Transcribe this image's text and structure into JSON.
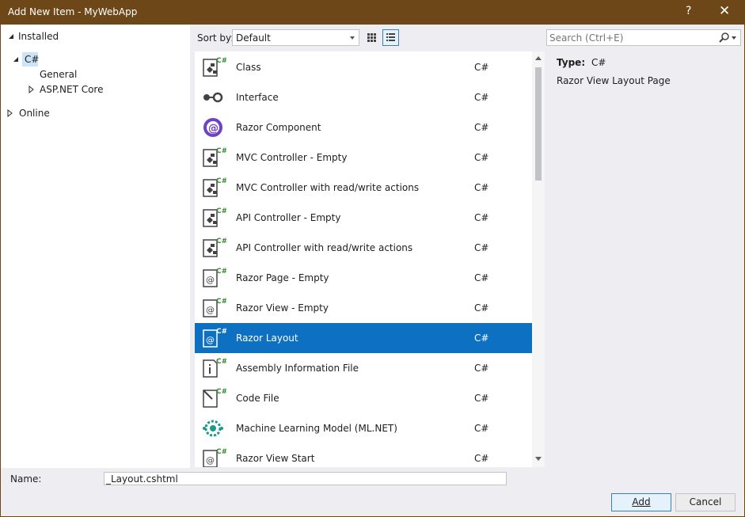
{
  "window": {
    "title": "Add New Item - MyWebApp",
    "help_glyph": "?",
    "close_glyph": "✕",
    "titlebar_color": "#6d4718"
  },
  "tree": {
    "installed": "Installed",
    "csharp": "C#",
    "general": "General",
    "aspnet": "ASP.NET Core",
    "online": "Online"
  },
  "toolbar": {
    "sort_label": "Sort by:",
    "sort_value": "Default",
    "grid_view_icon": "grid-icon",
    "list_view_icon": "list-icon"
  },
  "search": {
    "placeholder": "Search (Ctrl+E)"
  },
  "templates": [
    {
      "name": "Class",
      "lang": "C#",
      "icon": "class-icon"
    },
    {
      "name": "Interface",
      "lang": "C#",
      "icon": "interface-icon"
    },
    {
      "name": "Razor Component",
      "lang": "C#",
      "icon": "razor-component-icon"
    },
    {
      "name": "MVC Controller - Empty",
      "lang": "C#",
      "icon": "class-icon"
    },
    {
      "name": "MVC Controller with read/write actions",
      "lang": "C#",
      "icon": "class-icon"
    },
    {
      "name": "API Controller - Empty",
      "lang": "C#",
      "icon": "class-icon"
    },
    {
      "name": "API Controller with read/write actions",
      "lang": "C#",
      "icon": "class-icon"
    },
    {
      "name": "Razor Page - Empty",
      "lang": "C#",
      "icon": "razor-page-icon"
    },
    {
      "name": "Razor View - Empty",
      "lang": "C#",
      "icon": "razor-page-icon"
    },
    {
      "name": "Razor Layout",
      "lang": "C#",
      "icon": "razor-page-icon",
      "selected": true
    },
    {
      "name": "Assembly Information File",
      "lang": "C#",
      "icon": "info-file-icon"
    },
    {
      "name": "Code File",
      "lang": "C#",
      "icon": "code-file-icon"
    },
    {
      "name": "Machine Learning Model (ML.NET)",
      "lang": "C#",
      "icon": "ml-model-icon"
    },
    {
      "name": "Razor View Start",
      "lang": "C#",
      "icon": "razor-page-icon"
    }
  ],
  "details": {
    "type_label": "Type:",
    "type_value": "C#",
    "description": "Razor View Layout Page"
  },
  "footer": {
    "name_label": "Name:",
    "name_value": "_Layout.cshtml",
    "add_label": "Add",
    "cancel_label": "Cancel"
  },
  "colors": {
    "selection": "#0e70c0",
    "csharp_badge": "#388a34",
    "razor_purple": "#6f42c1"
  }
}
